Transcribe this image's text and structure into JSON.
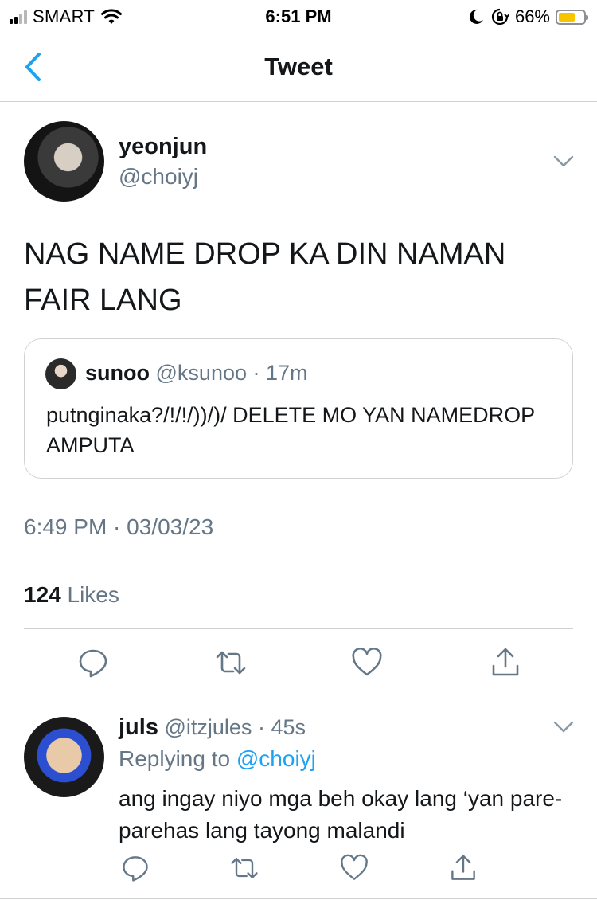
{
  "status_bar": {
    "carrier": "SMART",
    "time": "6:51 PM",
    "battery_percent": "66%",
    "battery_level": 0.66,
    "signal_bars_filled": 2,
    "signal_bars_total": 4,
    "icons": [
      "signal-icon",
      "wifi-icon",
      "moon-icon",
      "rotation-lock-icon",
      "battery-icon"
    ],
    "colors": {
      "battery_fill": "#f7c500"
    }
  },
  "nav": {
    "title": "Tweet",
    "back_icon": "chevron-left-icon"
  },
  "tweet": {
    "display_name": "yeonjun",
    "handle": "@choiyj",
    "text": "NAG NAME DROP KA DIN NAMAN FAIR LANG",
    "quote": {
      "display_name": "sunoo",
      "handle": "@ksunoo",
      "separator": "·",
      "age": "17m",
      "text": "putnginaka?/!/!/))/)/ DELETE MO YAN NAMEDROP AMPUTA"
    },
    "timestamp": "6:49 PM · 03/03/23",
    "likes_count": "124",
    "likes_label": "Likes",
    "actions": [
      "reply-icon",
      "retweet-icon",
      "like-icon",
      "share-icon"
    ]
  },
  "reply": {
    "display_name": "juls",
    "handle": "@itzjules",
    "separator": "·",
    "age": "45s",
    "replying_prefix": "Replying to",
    "replying_to": "@choiyj",
    "text": "ang ingay niyo mga beh okay lang ‘yan pare-parehas lang tayong malandi",
    "actions": [
      "reply-icon",
      "retweet-icon",
      "like-icon",
      "share-icon"
    ]
  },
  "colors": {
    "accent": "#1da1f2",
    "text_primary": "#14171a",
    "text_secondary": "#657786",
    "divider": "#cfd3d6"
  }
}
